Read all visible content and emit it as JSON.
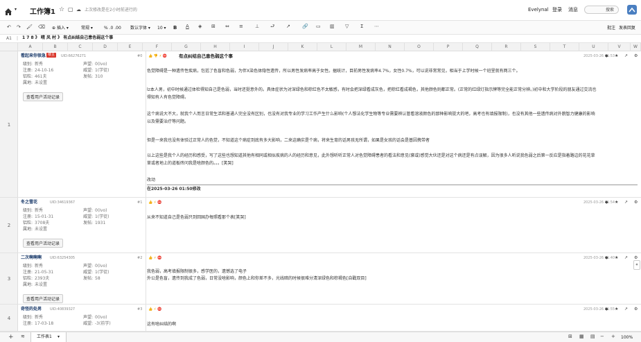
{
  "app": {
    "title": "工作簿1",
    "save_status": "上次修改是在2小时前进行的",
    "user": "Evelynal",
    "login": "登录",
    "messages": "消息",
    "search_placeholder": "搜索"
  },
  "toolbar": {
    "insert": "插入",
    "style": "常规",
    "font": "数认字体",
    "size": "10",
    "bold": "B",
    "comment": "批注",
    "share": "发表回复"
  },
  "formula_bar": {
    "cell": "A1",
    "content": "1 7 8  》 晴 风 村  》 有点纠结自己患色弱这个事"
  },
  "columns": [
    "A",
    "B",
    "C",
    "D",
    "E",
    "F",
    "G",
    "H",
    "I",
    "J",
    "K",
    "L",
    "M",
    "N",
    "O",
    "P",
    "Q",
    "R",
    "S",
    "T",
    "U",
    "V",
    "W",
    "X"
  ],
  "rows": [
    {
      "num": "1",
      "user": "看起来你很急",
      "badge": "楼主",
      "uid": "UID:66276271",
      "floor": "#0",
      "fields": [
        {
          "k": "级别:",
          "v": "新秀"
        },
        {
          "k": "声望:",
          "v": "0(Ivo)"
        },
        {
          "k": "注册:",
          "v": "24-10-16"
        },
        {
          "k": "威望:",
          "v": "1(学徒)"
        },
        {
          "k": "铝粒:",
          "v": "461夫"
        },
        {
          "k": "发帖:",
          "v": "310"
        },
        {
          "k": "属地:",
          "v": "未设置"
        }
      ],
      "activity": "查看用户活动记录",
      "post_title": "有点纠结自己患色弱这个事",
      "date": "2025-03-26 01:53",
      "paragraphs": [
        "色觉障碍是一种遗传性疾病，包括了色盲和色弱，为伴X染色体隐性遗传，所以男性发病率高于女性。据统计，目前男性发病率4.7%，女性0.7%，可以说非常常见，相当于上学时候一个班里就有两三个。",
        "lz本人男，初中时候通过体检得知自己是色弱，当时还挺意外的。具体症状为对深绿色和棕红色不太敏感，有时会把深绿看成灰色，把棕红看成褐色，其他颜色则都正常。(正常的红绿灯指示牌等完全能正常分辨。)初中和大学阶段的朋友通过交流也",
        "得知有人有色觉障碍。",
        "这个病说大不大，就我个人而言日常生活和普通人完全没有区别，也没有对我专业的学习工作产生什么影响(个人想法化学生物等专业需要辨认管看溶液颜色的那种影响挺大的吧，高考也有填报限制)，也没有其他一些遗传病对外貌智力健康的影响",
        "以及需要治疗等问题。",
        "但是一来我也没有体验过正常人的色觉，不知道这个病症到底有多大影响，二来这确实是个病，将来生育的话男孩无所谓，如果是女孩的话会是基因携带者",
        "以上这些是我个人的经历和感受，写了这些也想知道其他有相同或相似疾病的人的经历和意见，此外想听听正常人对色觉障碍患者的看法和意见(褒或)感觉大伙还是对这个病还是有点误解，因为很多人听说我色弱之后第一反应是指着路边的花花草",
        "草或者地上的道板砖问我是啥颜色的。。。[笑哭]"
      ],
      "edit_label": "改动",
      "edit_date": "在2025-03-26 01:50修改"
    },
    {
      "num": "2",
      "user": "冬之雪花",
      "uid": "UID:34619367",
      "floor": "#1",
      "fields": [
        {
          "k": "级别:",
          "v": "新秀"
        },
        {
          "k": "声望:",
          "v": "0(Ivo)"
        },
        {
          "k": "注册:",
          "v": "15-01-31"
        },
        {
          "k": "威望:",
          "v": "1(学徒)"
        },
        {
          "k": "铝粒:",
          "v": "3708夫"
        },
        {
          "k": "发帖:",
          "v": "1931"
        },
        {
          "k": "属地:",
          "v": "未设置"
        }
      ],
      "activity": "查看用户活动记录",
      "date": "2025-03-26 01:54",
      "paragraphs": [
        "从来不知道自己是色弱只到回国办每照看那个表[笑哭]"
      ]
    },
    {
      "num": "3",
      "user": "二次啊啊啊",
      "uid": "UID:63254305",
      "floor": "#2",
      "fields": [
        {
          "k": "级别:",
          "v": "新秀"
        },
        {
          "k": "声望:",
          "v": "0(Ivo)"
        },
        {
          "k": "注册:",
          "v": "21-05-31"
        },
        {
          "k": "威望:",
          "v": "1(学徒)"
        },
        {
          "k": "铝粒:",
          "v": "2393夫"
        },
        {
          "k": "发帖:",
          "v": "58"
        },
        {
          "k": "属地:",
          "v": "未设置"
        }
      ],
      "activity": "查看用户活动记录",
      "date": "2025-03-26 01:40",
      "paragraphs": [
        "我色弱，高考填报限制很多，感学医的，遗憾选了电子",
        "外公是色盲，遗传到我成了色弱，日常没啥影响，颜色上和你差不多，光线暗的时候很难分清深绿色和棕褐色[自戳双目]"
      ]
    },
    {
      "num": "4",
      "user": "奇怪的处男",
      "uid": "UID:40839327",
      "floor": "#3",
      "fields": [
        {
          "k": "级别:",
          "v": "新秀"
        },
        {
          "k": "声望:",
          "v": "0(Ivo)"
        },
        {
          "k": "注册:",
          "v": "17-03-18"
        },
        {
          "k": "威望:",
          "v": "-3(前学)"
        }
      ],
      "date": "2025-03-26 01:55",
      "paragraphs": [
        "这有啥纠结的啊"
      ]
    }
  ],
  "sheet_tab": "工作表1",
  "zoom": "100%",
  "colors": {
    "badge": "#d9362b",
    "accent": "#1a73e8"
  }
}
